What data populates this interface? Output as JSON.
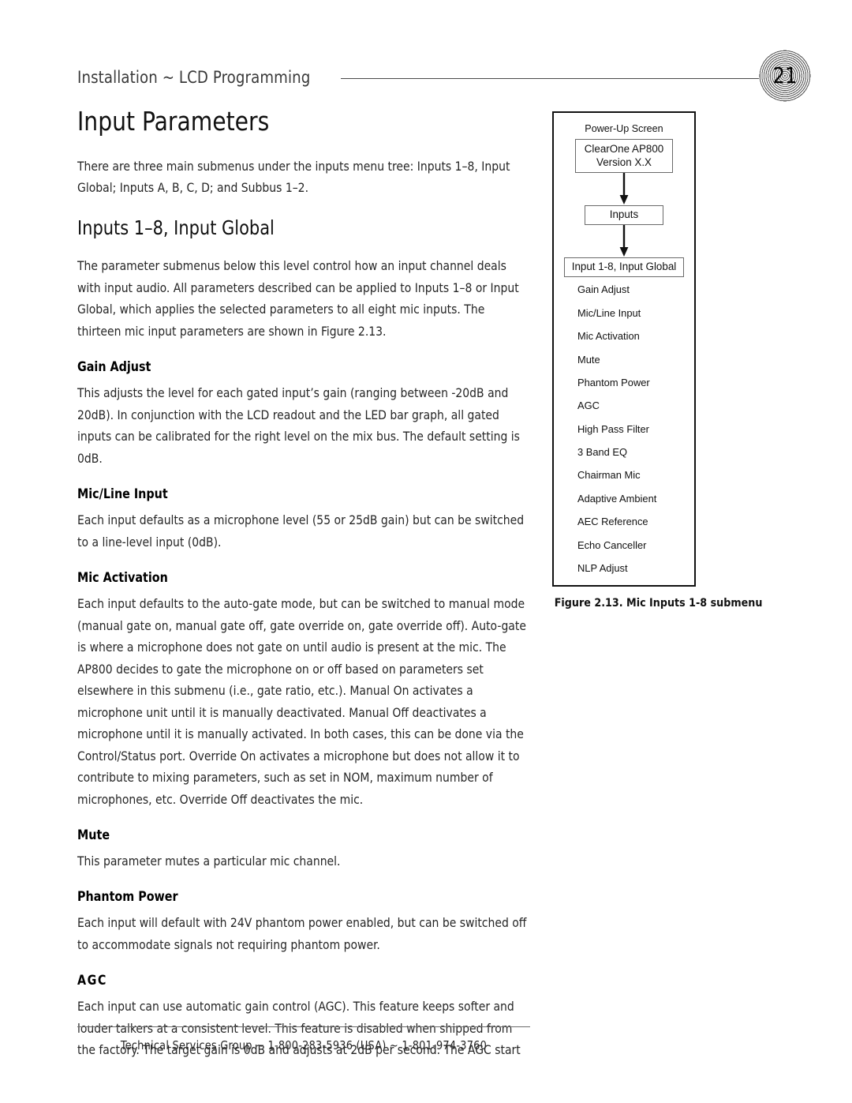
{
  "header": {
    "title": "Installation ~ LCD Programming",
    "page_number": "21"
  },
  "main": {
    "title": "Input Parameters",
    "intro": "There are three main submenus under the inputs menu tree: Inputs 1–8, Input Global; Inputs A, B, C, D; and Subbus 1–2.",
    "section_title": "Inputs 1–8, Input Global",
    "section_intro": "The parameter submenus below this level control how an input channel deals with input audio. All parameters described can be applied to Inputs 1–8 or Input Global, which applies the selected parameters to all eight mic inputs. The thirteen mic input parameters are shown in Figure 2.13.",
    "subsections": [
      {
        "heading": "Gain Adjust",
        "body": "This adjusts the level for each gated input’s gain (ranging between -20dB and 20dB). In conjunction with the LCD readout and the LED bar graph, all gated inputs can be calibrated for the right level on the mix bus. The default setting is 0dB."
      },
      {
        "heading": "Mic/Line Input",
        "body": "Each input defaults as a microphone level (55 or 25dB gain) but can be switched to a line-level input (0dB)."
      },
      {
        "heading": "Mic Activation",
        "body": "Each input defaults to the auto-gate mode, but can be switched to manual mode (manual gate on, manual gate off, gate override on, gate override off). Auto-gate is where a microphone does not gate on until audio is present at the mic. The AP800 decides to gate the microphone on or off based on parameters set elsewhere in this submenu (i.e., gate ratio, etc.). Manual On activates a microphone unit until it is manually deactivated. Manual Off deactivates a microphone until it is manually activated. In both cases, this can be done via the Control/Status port. Override On activates a microphone but does not allow it to contribute to mixing parameters, such as set in NOM, maximum number of microphones, etc. Override Off deactivates the mic."
      },
      {
        "heading": "Mute",
        "body": "This parameter mutes a particular mic channel."
      },
      {
        "heading": "Phantom Power",
        "body": "Each input will default with 24V phantom power enabled, but can be switched off to accommodate signals not requiring phantom power."
      },
      {
        "heading": "AGC",
        "body": "Each input can use automatic gain control (AGC). This feature keeps softer and louder talkers at a consistent level. This feature is disabled when shipped from the factory. The target gain is 0dB and adjusts at 2dB per second. The AGC start"
      }
    ]
  },
  "figure": {
    "top_label": "Power-Up Screen",
    "lcd_line1": "ClearOne  AP800",
    "lcd_line2": "Version X.X",
    "node_inputs": "Inputs",
    "node_submenu": "Input 1-8, Input Global",
    "menu_items": [
      "Gain Adjust",
      "Mic/Line Input",
      "Mic Activation",
      "Mute",
      "Phantom Power",
      "AGC",
      "High Pass Filter",
      "3 Band EQ",
      "Chairman Mic",
      "Adaptive Ambient",
      "AEC Reference",
      "Echo Canceller",
      "NLP Adjust"
    ],
    "caption": "Figure 2.13.  Mic Inputs 1-8 submenu"
  },
  "footer": {
    "text": "Technical Services Group ~ 1-800-283-5936 (USA) ~ 1-801-974-3760"
  }
}
